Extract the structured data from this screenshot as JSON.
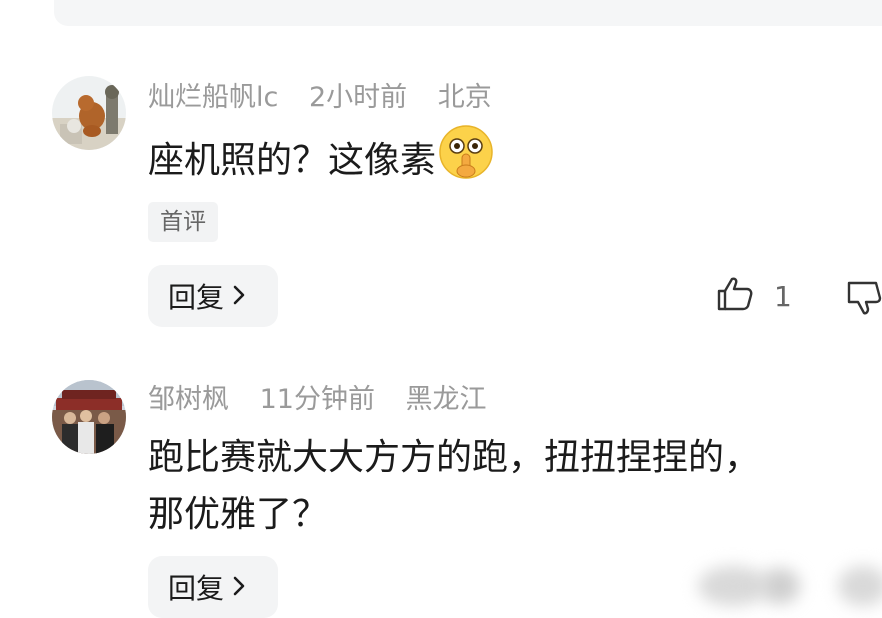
{
  "comments": [
    {
      "username": "灿烂船帆lc",
      "time": "2小时前",
      "location": "北京",
      "text": "座机照的？这像素",
      "emoji": "shush-emoji",
      "tag": "首评",
      "reply_label": "回复",
      "like_count": "1"
    },
    {
      "username": "邹树枫",
      "time": "11分钟前",
      "location": "黑龙江",
      "text_line1": "跑比赛就大大方方的跑，扭扭捏捏的，",
      "text_line2": "那优雅了？",
      "reply_label": "回复"
    }
  ],
  "colors": {
    "meta": "#9a9a9a",
    "text": "#1b1b1b",
    "button_bg": "#f3f4f5",
    "tag_bg": "#f2f3f4"
  }
}
